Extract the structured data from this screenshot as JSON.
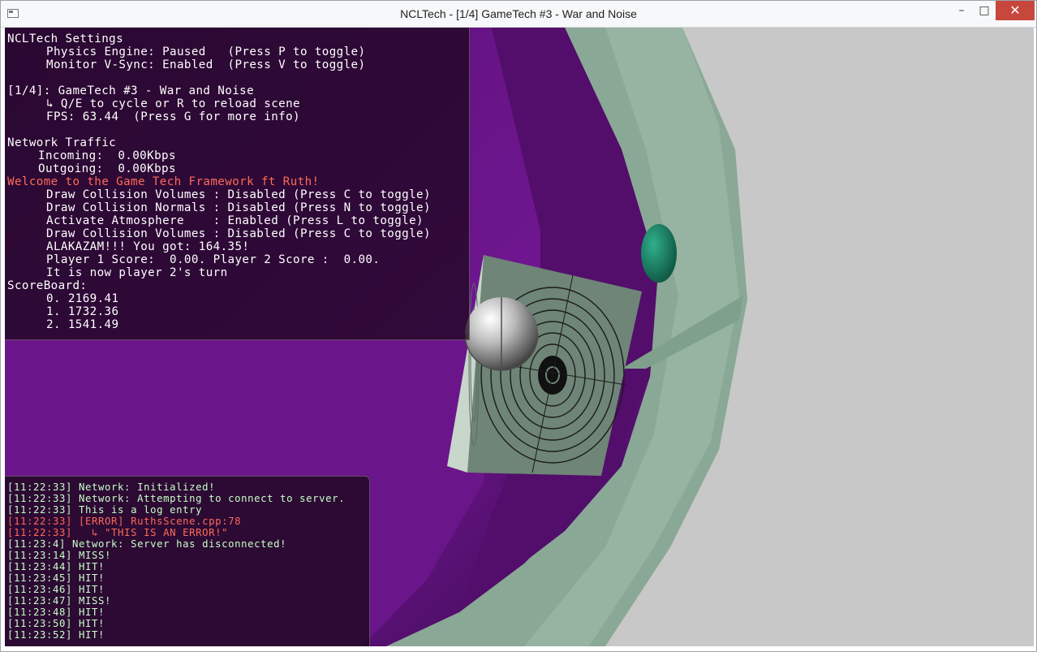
{
  "window": {
    "title": "NCLTech - [1/4] GameTech #3 - War and Noise",
    "minimize_glyph": "–",
    "maximize_glyph": "□",
    "close_glyph": "✕"
  },
  "hud": {
    "settings_header": "NCLTech Settings",
    "physics_engine": "Physics Engine: Paused   (Press P to toggle)",
    "vsync": "Monitor V-Sync: Enabled  (Press V to toggle)",
    "scene_title": "[1/4]: GameTech #3 - War and Noise",
    "scene_hint": "↳ Q/E to cycle or R to reload scene",
    "fps": "FPS: 63.44  (Press G for more info)",
    "network_header": "Network Traffic",
    "incoming": "Incoming:  0.00Kbps",
    "outgoing": "Outgoing:  0.00Kbps",
    "welcome": "Welcome to the Game Tech Framework ft Ruth!",
    "collision_volumes": "Draw Collision Volumes : Disabled (Press C to toggle)",
    "collision_normals": "Draw Collision Normals : Disabled (Press N to toggle)",
    "atmosphere": "Activate Atmosphere    : Enabled (Press L to toggle)",
    "collision_volumes_2": "Draw Collision Volumes : Disabled (Press C to toggle)",
    "alakazam": "ALAKAZAM!!! You got: 164.35!",
    "scores": "Player 1 Score:  0.00. Player 2 Score :  0.00.",
    "turn": "It is now player 2's turn",
    "scoreboard_header": "ScoreBoard:",
    "scoreboard": [
      "0. 2169.41",
      "1. 1732.36",
      "2. 1541.49"
    ]
  },
  "log": [
    {
      "text": "[11:22:33] Network: Initialized!",
      "level": "info"
    },
    {
      "text": "[11:22:33] Network: Attempting to connect to server.",
      "level": "info"
    },
    {
      "text": "[11:22:33] This is a log entry",
      "level": "info"
    },
    {
      "text": "[11:22:33] [ERROR] RuthsScene.cpp:78",
      "level": "error"
    },
    {
      "text": "[11:22:33]   ↳ \"THIS IS AN ERROR!\"",
      "level": "error"
    },
    {
      "text": "[11:23:4] Network: Server has disconnected!",
      "level": "info"
    },
    {
      "text": "[11:23:14] MISS!",
      "level": "info"
    },
    {
      "text": "[11:23:44] HIT!",
      "level": "info"
    },
    {
      "text": "[11:23:45] HIT!",
      "level": "info"
    },
    {
      "text": "[11:23:46] HIT!",
      "level": "info"
    },
    {
      "text": "[11:23:47] MISS!",
      "level": "info"
    },
    {
      "text": "[11:23:48] HIT!",
      "level": "info"
    },
    {
      "text": "[11:23:50] HIT!",
      "level": "info"
    },
    {
      "text": "[11:23:52] HIT!",
      "level": "info"
    }
  ],
  "colors": {
    "purple_surface": "#6a1488",
    "green_shell": "#8aa896",
    "background": "#c8c8c8",
    "hud_text": "#ffffff",
    "hud_highlight": "#ff6a5a",
    "log_text": "#c8ffc8"
  }
}
